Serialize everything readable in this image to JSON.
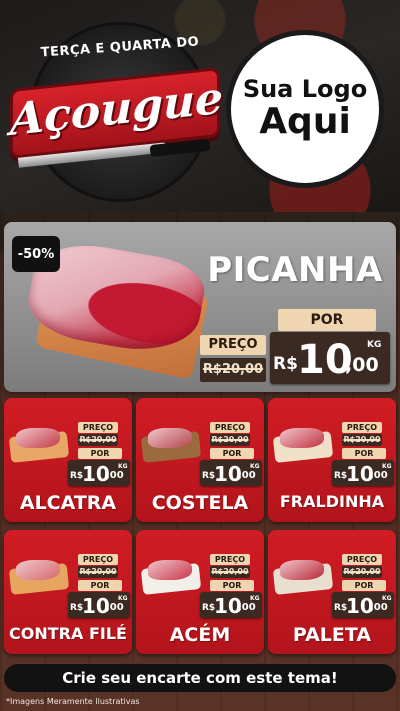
{
  "header": {
    "badge_top": "TERÇA E QUARTA DO",
    "badge_main": "Açougue",
    "logo_line1": "Sua Logo",
    "logo_line2": "Aqui"
  },
  "featured": {
    "discount": "-50%",
    "name": "PICANHA",
    "preco_label": "PREÇO",
    "old_price": "R$20,00",
    "por_label": "POR",
    "currency": "R$",
    "price_int": "10",
    "price_dec": ",00",
    "unit": "KG"
  },
  "products": [
    {
      "name": "ALCATRA",
      "preco_label": "PREÇO",
      "old_price": "R$20,00",
      "por_label": "POR",
      "currency": "R$",
      "price_int": "10",
      "price_dec": ",00",
      "unit": "KG"
    },
    {
      "name": "COSTELA",
      "preco_label": "PREÇO",
      "old_price": "R$20,00",
      "por_label": "POR",
      "currency": "R$",
      "price_int": "10",
      "price_dec": ",00",
      "unit": "KG"
    },
    {
      "name": "FRALDINHA",
      "preco_label": "PREÇO",
      "old_price": "R$20,00",
      "por_label": "POR",
      "currency": "R$",
      "price_int": "10",
      "price_dec": ",00",
      "unit": "KG"
    },
    {
      "name": "CONTRA FILÉ",
      "preco_label": "PREÇO",
      "old_price": "R$20,00",
      "por_label": "POR",
      "currency": "R$",
      "price_int": "10",
      "price_dec": ",00",
      "unit": "KG"
    },
    {
      "name": "ACÉM",
      "preco_label": "PREÇO",
      "old_price": "R$20,00",
      "por_label": "POR",
      "currency": "R$",
      "price_int": "10",
      "price_dec": ",00",
      "unit": "KG"
    },
    {
      "name": "PALETA",
      "preco_label": "PREÇO",
      "old_price": "R$20,00",
      "por_label": "POR",
      "currency": "R$",
      "price_int": "10",
      "price_dec": ",00",
      "unit": "KG"
    }
  ],
  "cta": "Crie seu encarte com este tema!",
  "footnote": "*Imagens Meramente Ilustrativas",
  "colors": {
    "card_red": "#d11c24",
    "tag_cream": "#efd6b0",
    "tag_brown": "#3b2a22",
    "cta_bg": "#121212"
  }
}
